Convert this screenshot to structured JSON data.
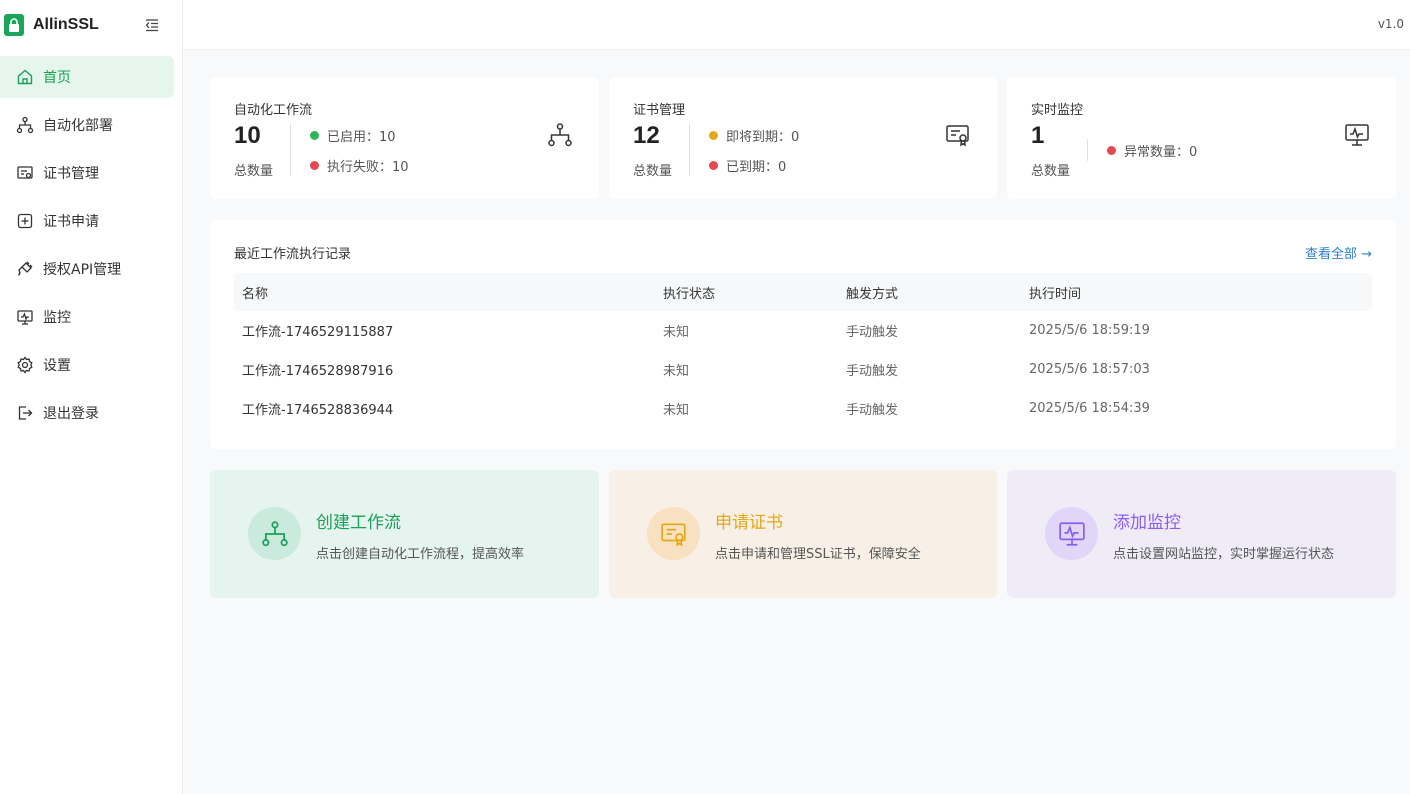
{
  "app": {
    "name": "AllinSSL",
    "version": "v1.0",
    "logo_text": "AllinSSL"
  },
  "sidebar": {
    "items": [
      {
        "label": "首页",
        "icon": "home-icon",
        "active": true
      },
      {
        "label": "自动化部署",
        "icon": "workflow-icon",
        "active": false
      },
      {
        "label": "证书管理",
        "icon": "certificate-icon",
        "active": false
      },
      {
        "label": "证书申请",
        "icon": "plus-square-icon",
        "active": false
      },
      {
        "label": "授权API管理",
        "icon": "api-plug-icon",
        "active": false
      },
      {
        "label": "监控",
        "icon": "monitor-icon",
        "active": false
      },
      {
        "label": "设置",
        "icon": "gear-icon",
        "active": false
      },
      {
        "label": "退出登录",
        "icon": "logout-icon",
        "active": false
      }
    ]
  },
  "stats": {
    "workflow": {
      "title": "自动化工作流",
      "total": "10",
      "total_label": "总数量",
      "enabled": "已启用：10",
      "failed": "执行失败：10"
    },
    "cert": {
      "title": "证书管理",
      "total": "12",
      "total_label": "总数量",
      "expiring": "即将到期：0",
      "expired": "已到期：0"
    },
    "monitor": {
      "title": "实时监控",
      "total": "1",
      "total_label": "总数量",
      "abnormal": "异常数量：0"
    }
  },
  "records": {
    "title": "最近工作流执行记录",
    "view_all": "查看全部 →",
    "columns": [
      "名称",
      "执行状态",
      "触发方式",
      "执行时间"
    ],
    "rows": [
      {
        "name": "工作流-1746529115887",
        "status": "未知",
        "trigger": "手动触发",
        "time": "2025/5/6 18:59:19"
      },
      {
        "name": "工作流-1746528987916",
        "status": "未知",
        "trigger": "手动触发",
        "time": "2025/5/6 18:57:03"
      },
      {
        "name": "工作流-1746528836944",
        "status": "未知",
        "trigger": "手动触发",
        "time": "2025/5/6 18:54:39"
      }
    ]
  },
  "quick_actions": [
    {
      "title": "创建工作流",
      "desc": "点击创建自动化工作流程，提高效率"
    },
    {
      "title": "申请证书",
      "desc": "点击申请和管理SSL证书，保障安全"
    },
    {
      "title": "添加监控",
      "desc": "点击设置网站监控，实时掌握运行状态"
    }
  ],
  "colors": {
    "accent": "#18a058",
    "green": "#2db55d",
    "red": "#e5484d",
    "yellow": "#e6a817",
    "purple": "#8b5cf6",
    "link": "#2f7fd0"
  }
}
